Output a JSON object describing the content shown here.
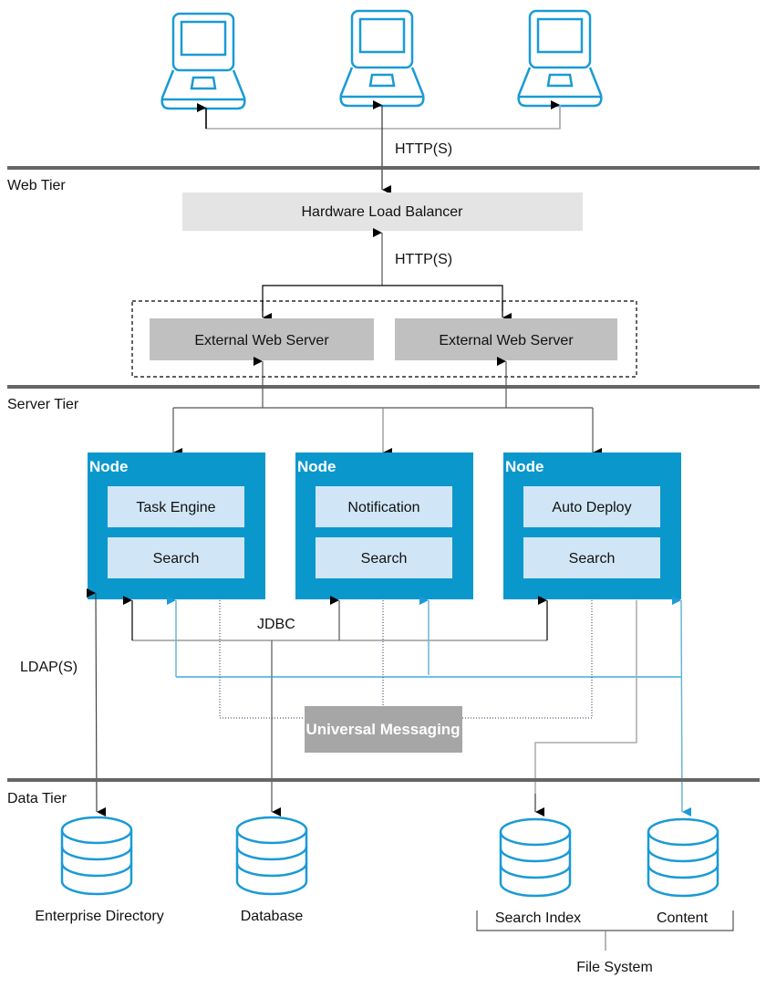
{
  "colors": {
    "node_blue": "#0a98cc",
    "component_fill": "#d0e6f6",
    "load_balancer_fill": "#e4e4e4",
    "web_server_fill": "#c0c0c0",
    "messaging_fill": "#a6a6a6",
    "tier_line": "#666666",
    "icon_blue": "#1a9ad6",
    "connector_blue": "#1a9ad6",
    "connector_black": "#000000",
    "connector_gray": "#aaaaaa"
  },
  "clients": [
    {
      "icon": "laptop-icon"
    },
    {
      "icon": "laptop-icon"
    },
    {
      "icon": "laptop-icon"
    }
  ],
  "tiers": {
    "web": "Web Tier",
    "server": "Server Tier",
    "data": "Data Tier"
  },
  "protocols": {
    "client_http": "HTTP(S)",
    "lb_http": "HTTP(S)",
    "jdbc": "JDBC",
    "ldap": "LDAP(S)"
  },
  "web_tier": {
    "load_balancer": "Hardware Load Balancer",
    "web_servers": [
      "External Web Server",
      "External Web Server"
    ]
  },
  "nodes": [
    {
      "title": "Node",
      "components": [
        "Task Engine",
        "Search"
      ]
    },
    {
      "title": "Node",
      "components": [
        "Notification",
        "Search"
      ]
    },
    {
      "title": "Node",
      "components": [
        "Auto Deploy",
        "Search"
      ]
    }
  ],
  "messaging": "Universal Messaging",
  "data_stores": [
    {
      "label": "Enterprise Directory",
      "icon": "database-icon"
    },
    {
      "label": "Database",
      "icon": "database-icon"
    },
    {
      "label": "Search Index",
      "icon": "database-icon"
    },
    {
      "label": "Content",
      "icon": "database-icon"
    }
  ],
  "file_system": "File System"
}
